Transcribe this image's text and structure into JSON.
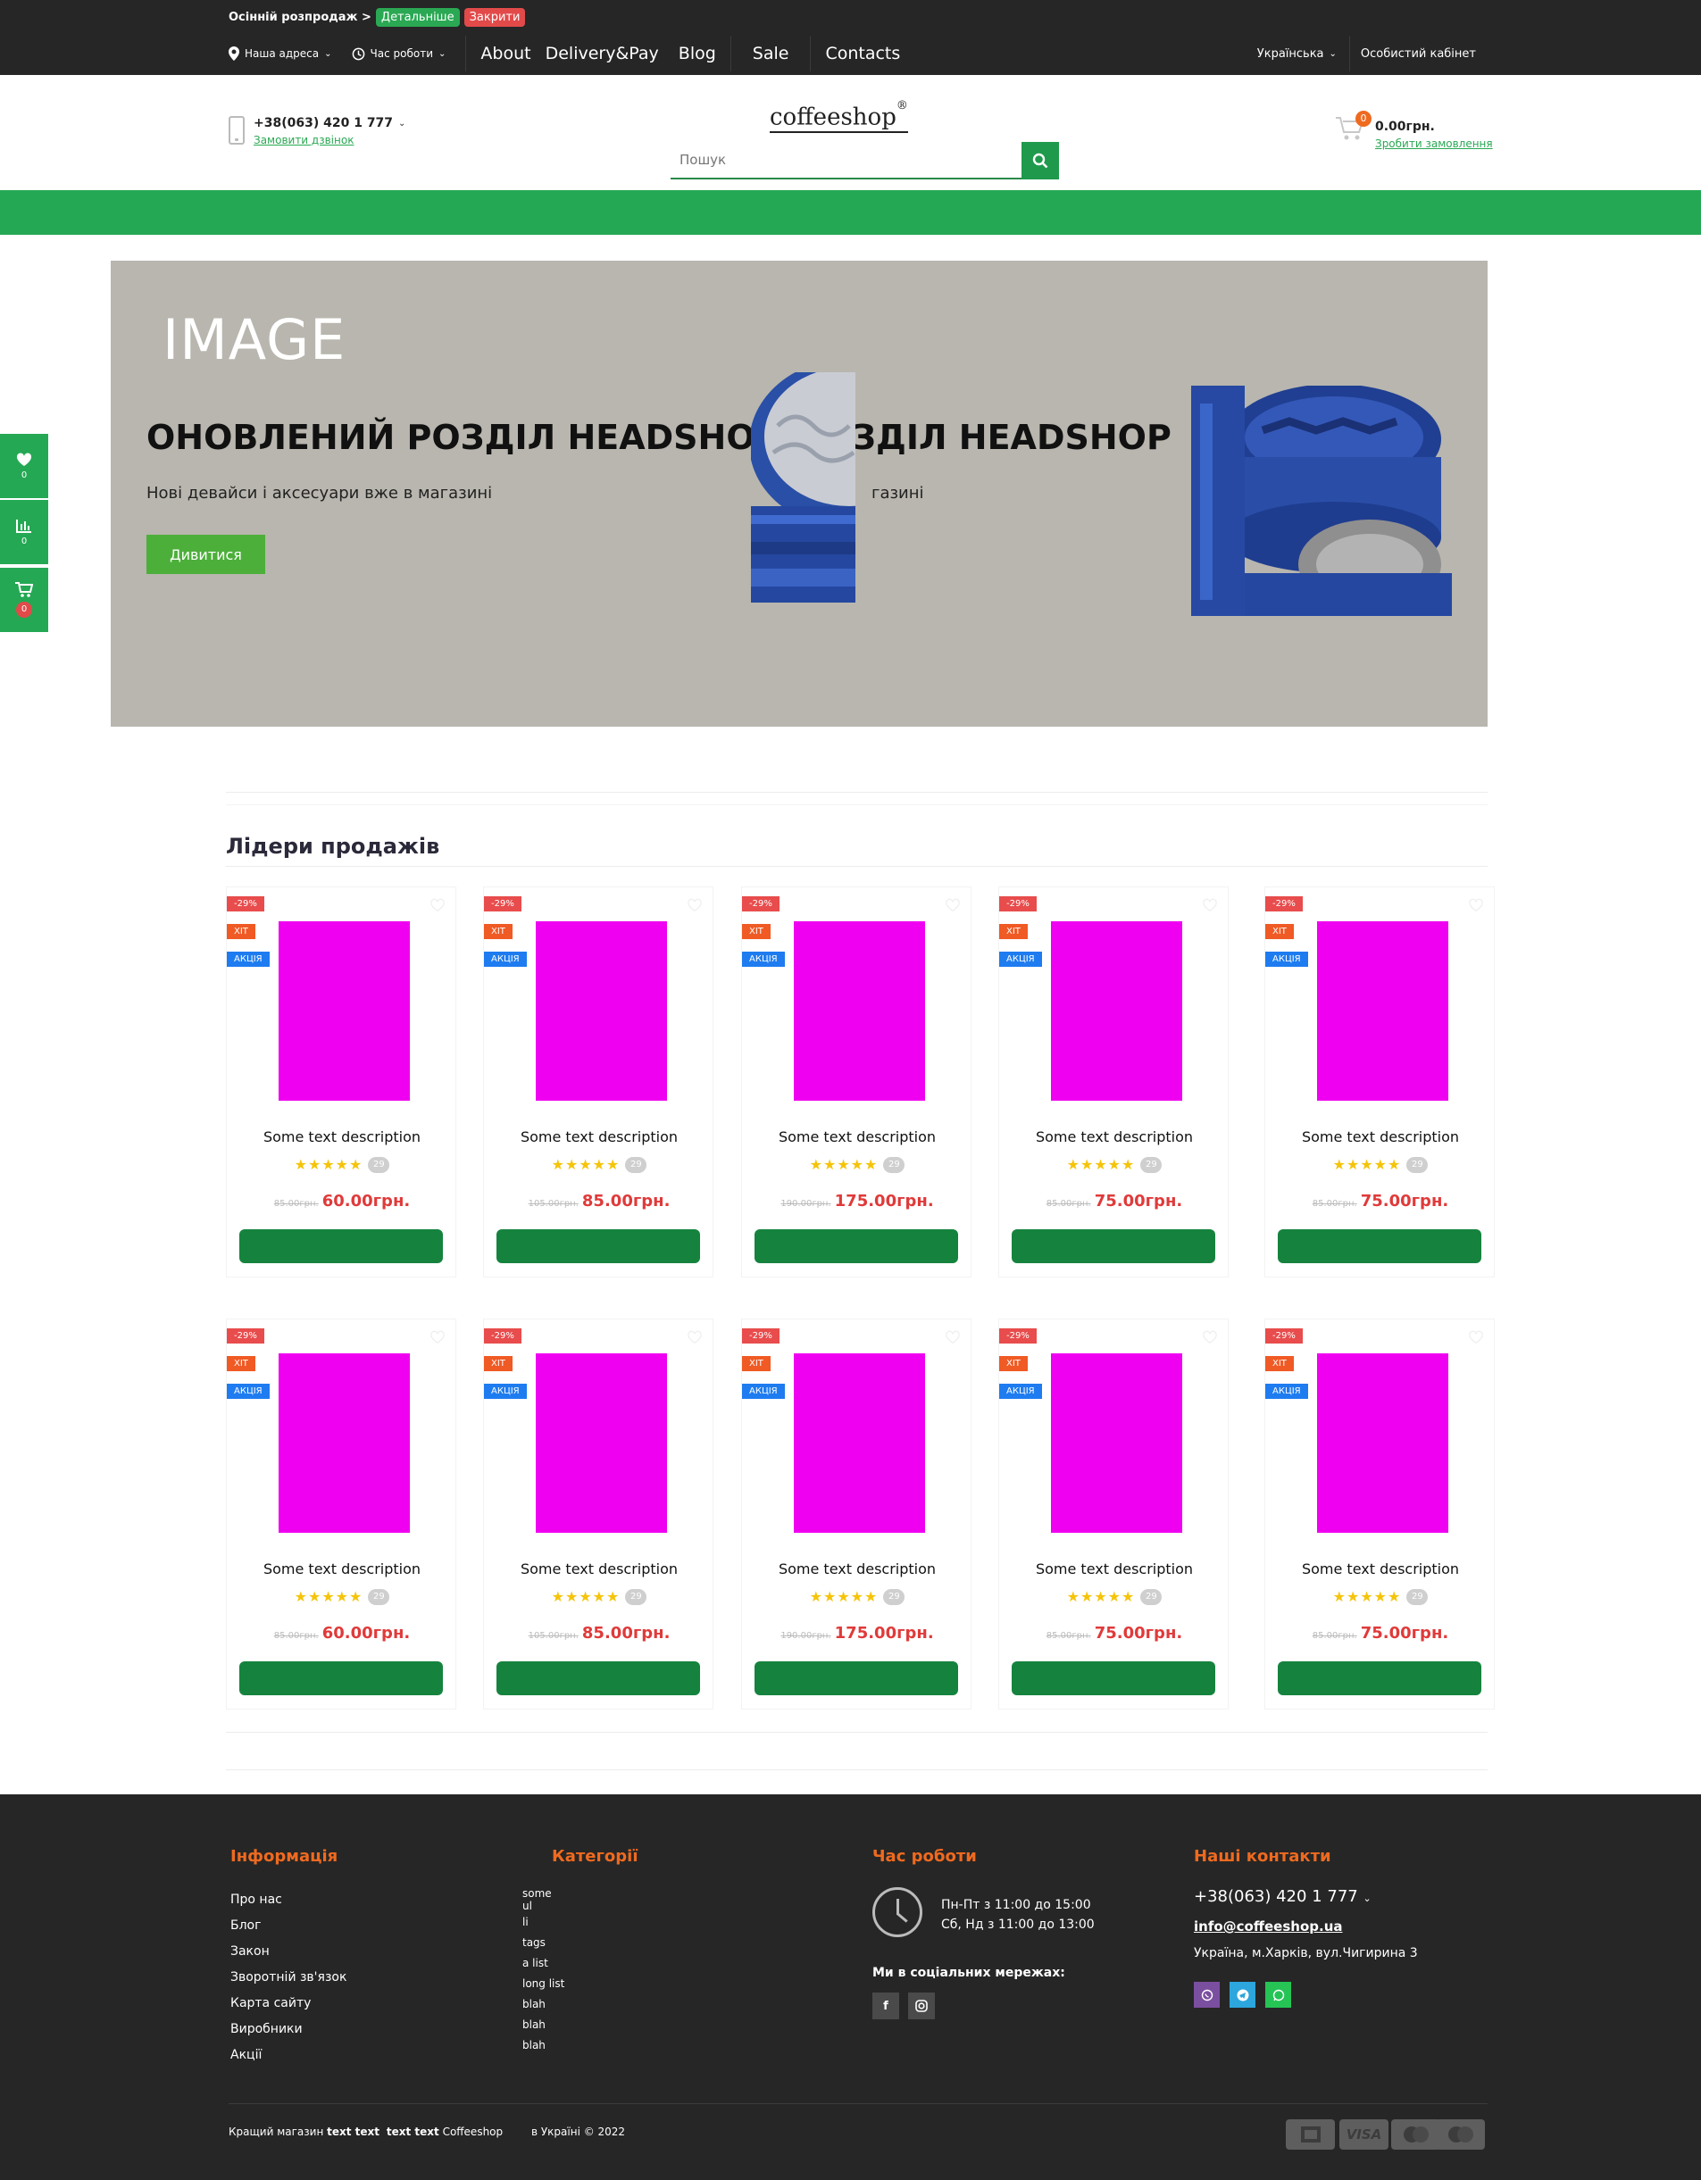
{
  "promo": {
    "text": "Осінній розпродаж >",
    "details": "Детальніше",
    "close": "Закрити"
  },
  "nav": {
    "address": "Наша адреса",
    "hours": "Час роботи",
    "links": [
      "About",
      "Delivery&Pay",
      "Blog",
      "Sale",
      "Contacts"
    ],
    "language": "Українська",
    "account": "Особистий кабінет"
  },
  "header": {
    "phone": "+38(063) 420 1 777",
    "callback": "Замовити дзвінок",
    "logo": "coffeeshop",
    "logo_mark": "®",
    "search_placeholder": "Пошук",
    "cart_count": "0",
    "cart_sum": "0.00грн.",
    "checkout": "Зробити замовлення"
  },
  "banner": {
    "image_label": "IMAGE",
    "title": "ОНОВЛЕНИЙ РОЗДІЛ HEADSHOP",
    "title_fragment": "ЗДІЛ HEADSHOP",
    "subtitle": "Нові девайси і аксесуари вже в магазині",
    "subtitle_fragment": "газині",
    "button": "Дивитися"
  },
  "side": {
    "wishlist_count": "0",
    "compare_count": "0",
    "cart_count": "0"
  },
  "section_title": "Лідери продажів",
  "products": [
    {
      "name": "Some text description",
      "discount": "-29%",
      "hit": "ХІТ",
      "sale": "АКЦІЯ",
      "old_price": "85.00грн.",
      "price": "60.00грн.",
      "reviews": "29"
    },
    {
      "name": "Some text description",
      "discount": "-29%",
      "hit": "ХІТ",
      "sale": "АКЦІЯ",
      "old_price": "105.00грн.",
      "price": "85.00грн.",
      "reviews": "29"
    },
    {
      "name": "Some text description",
      "discount": "-29%",
      "hit": "ХІТ",
      "sale": "АКЦІЯ",
      "old_price": "190.00грн.",
      "price": "175.00грн.",
      "reviews": "29"
    },
    {
      "name": "Some text description",
      "discount": "-29%",
      "hit": "ХІТ",
      "sale": "АКЦІЯ",
      "old_price": "85.00грн.",
      "price": "75.00грн.",
      "reviews": "29"
    },
    {
      "name": "Some text description",
      "discount": "-29%",
      "hit": "ХІТ",
      "sale": "АКЦІЯ",
      "old_price": "85.00грн.",
      "price": "75.00грн.",
      "reviews": "29"
    },
    {
      "name": "Some text description",
      "discount": "-29%",
      "hit": "ХІТ",
      "sale": "АКЦІЯ",
      "old_price": "85.00грн.",
      "price": "60.00грн.",
      "reviews": "29"
    },
    {
      "name": "Some text description",
      "discount": "-29%",
      "hit": "ХІТ",
      "sale": "АКЦІЯ",
      "old_price": "105.00грн.",
      "price": "85.00грн.",
      "reviews": "29"
    },
    {
      "name": "Some text description",
      "discount": "-29%",
      "hit": "ХІТ",
      "sale": "АКЦІЯ",
      "old_price": "190.00грн.",
      "price": "175.00грн.",
      "reviews": "29"
    },
    {
      "name": "Some text description",
      "discount": "-29%",
      "hit": "ХІТ",
      "sale": "АКЦІЯ",
      "old_price": "85.00грн.",
      "price": "75.00грн.",
      "reviews": "29"
    },
    {
      "name": "Some text description",
      "discount": "-29%",
      "hit": "ХІТ",
      "sale": "АКЦІЯ",
      "old_price": "85.00грн.",
      "price": "75.00грн.",
      "reviews": "29"
    }
  ],
  "footer": {
    "info_title": "Інформація",
    "info_links": [
      "Про нас",
      "Блог",
      "Закон",
      "Зворотній зв'язок",
      "Карта сайту",
      "Виробники",
      "Акції"
    ],
    "cat_title": "Категорії",
    "categories": [
      "some",
      "ul",
      "li",
      "tags",
      "a list",
      "long list",
      "blah",
      "blah",
      "blah"
    ],
    "hours_title": "Час роботи",
    "hours": [
      "Пн-Пт з 11:00 до 15:00",
      "Сб, Нд з 11:00 до 13:00"
    ],
    "social_title": "Ми в соціальних мережах:",
    "contacts_title": "Наші контакти",
    "phone": "+38(063) 420 1 777",
    "email": "info@coffeeshop.ua",
    "address": "Україна, м.Харків, вул.Чигирина 3",
    "copyright_a": "Кращий магазин",
    "copyright_b": "text text",
    "copyright_c": "text text",
    "copyright_d": "Coffeeshop",
    "copyright_e": "в Україні © 2022",
    "payments": [
      "VISA"
    ]
  },
  "colors": {
    "green": "#25a854",
    "dark": "#262626",
    "orange": "#ef6a1f",
    "price_red": "#e03a3a",
    "placeholder": "#f000f0"
  }
}
